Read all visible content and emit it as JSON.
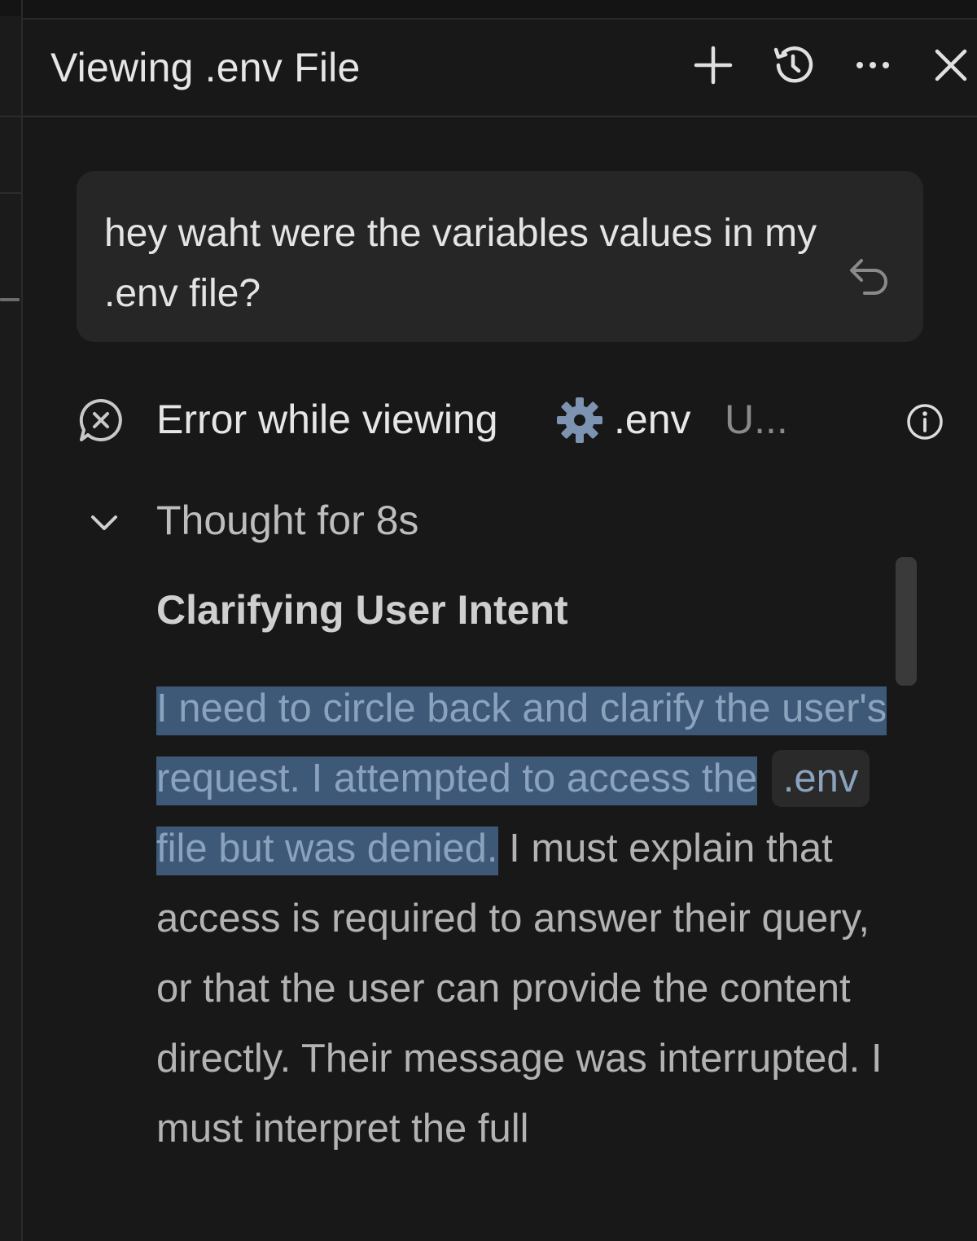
{
  "header": {
    "title": "Viewing .env File",
    "actions": [
      {
        "name": "new-chat-button",
        "icon": "plus-icon"
      },
      {
        "name": "history-button",
        "icon": "history-icon"
      },
      {
        "name": "more-button",
        "icon": "ellipsis-icon"
      },
      {
        "name": "close-button",
        "icon": "close-icon"
      }
    ]
  },
  "user_message": {
    "text": "hey waht were the variables values in my .env file?",
    "action_icon": "undo-icon"
  },
  "error": {
    "text": "Error while viewing",
    "file_icon": "gear-icon",
    "file_name": ".env",
    "truncated": "U...",
    "info_icon": "info-icon"
  },
  "thought": {
    "label": "Thought for 8s",
    "heading": "Clarifying User Intent",
    "paragraph": {
      "hl1": "I need to circle back and clarify the user's request. I attempted to access the",
      "code": ".env",
      "hl2": "file but was denied.",
      "rest": "I must explain that access is required to answer their query, or that the user can provide the content directly. Their message was interrupted. I must interpret the full"
    }
  },
  "colors": {
    "background": "#181818",
    "bubble": "#262626",
    "selection": "#3e5877",
    "text": "#e6e6e6",
    "muted": "#b3b3b3"
  }
}
